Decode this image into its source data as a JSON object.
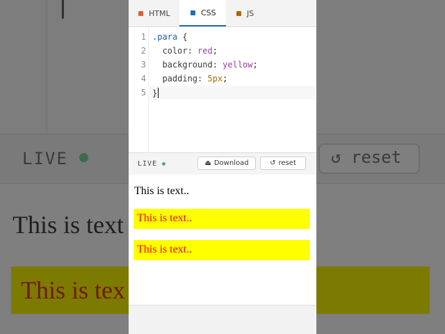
{
  "background": {
    "live_label": "LIVE",
    "reset_label": "reset",
    "reset_icon": "reset-icon",
    "text_plain": "This is text",
    "text_para": "This is tex"
  },
  "tabs": [
    {
      "label": "HTML",
      "color": "#e06030"
    },
    {
      "label": "CSS",
      "color": "#1f6fb2"
    },
    {
      "label": "JS",
      "color": "#b0640a"
    }
  ],
  "editor": {
    "active_tab": "CSS",
    "line_numbers": [
      "1",
      "2",
      "3",
      "4",
      "5"
    ],
    "lines": [
      {
        "sel": ".para",
        "rest": " {"
      },
      {
        "prop": "  color: ",
        "val": "red",
        "end": ";"
      },
      {
        "prop": "  background: ",
        "val": "yellow",
        "end": ";"
      },
      {
        "prop": "  padding: ",
        "val": "5px",
        "end": ";"
      },
      {
        "text": "}"
      }
    ]
  },
  "toolbar": {
    "live_label": "LIVE",
    "download_label": "Download",
    "download_icon": "download-icon",
    "reset_label": "reset",
    "reset_icon": "reset-icon"
  },
  "preview": {
    "items": [
      "This is text..",
      "This is text..",
      "This is text.."
    ]
  },
  "colors": {
    "accent": "#1f6fb2",
    "live_dot": "#5aa87b",
    "para_bg": "#ffff00",
    "para_text": "#ff0000"
  }
}
